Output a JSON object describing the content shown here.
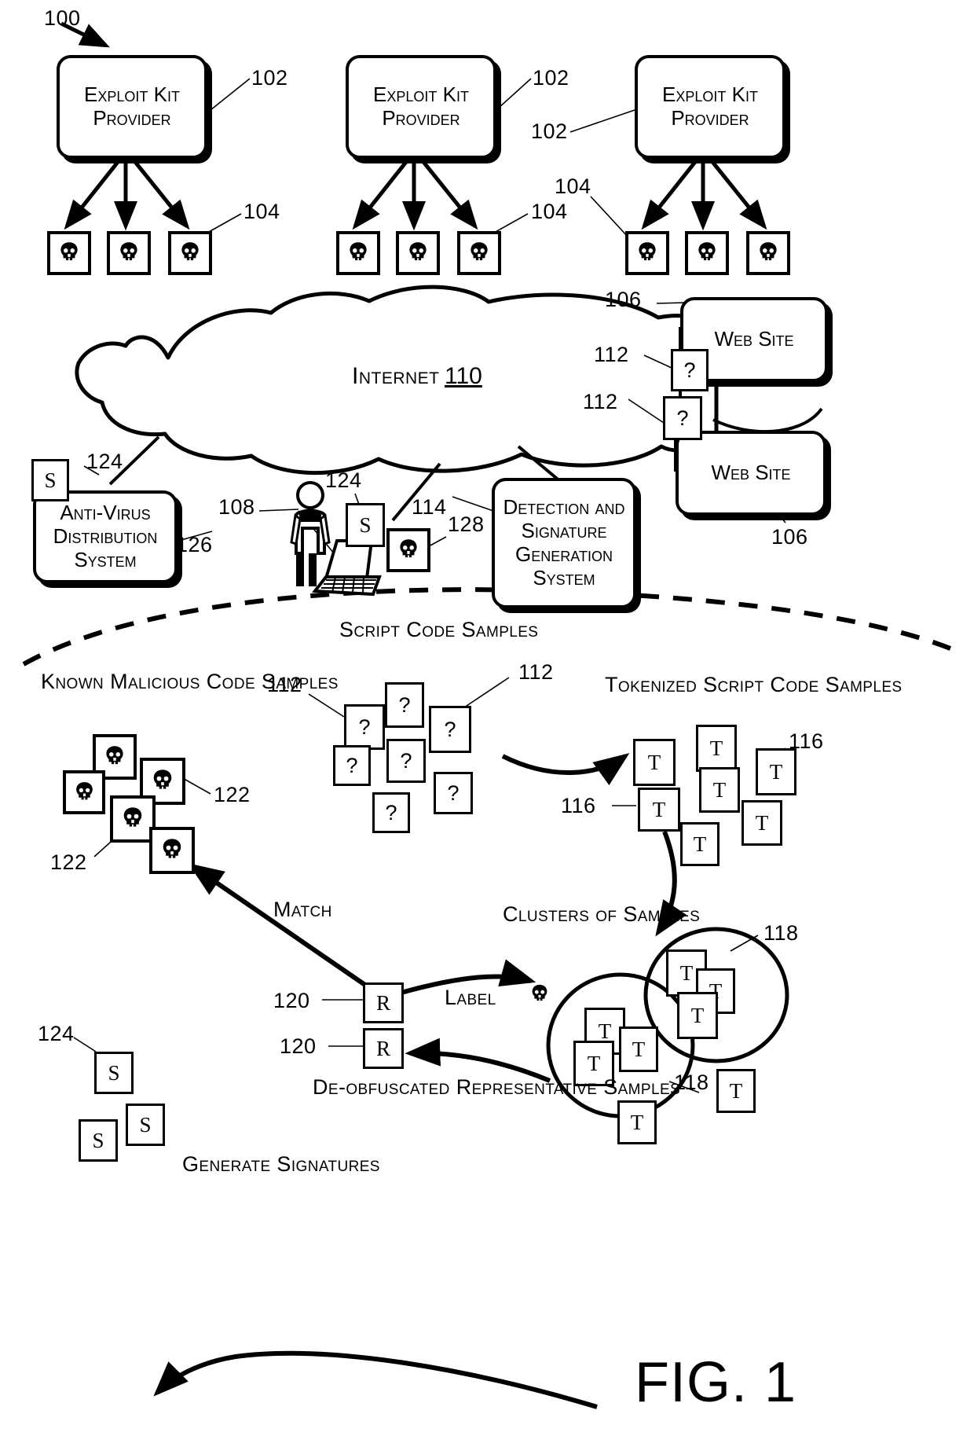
{
  "figure": {
    "number_label": "FIG. 1",
    "system_ref": "100"
  },
  "top_row": {
    "providers": [
      {
        "label": "Exploit Kit Provider",
        "ref": "102"
      },
      {
        "label": "Exploit Kit Provider",
        "ref": "102"
      },
      {
        "label": "Exploit Kit Provider",
        "ref": "102"
      }
    ],
    "provider_extra_ref": "102",
    "malicious_code_refs": [
      "104",
      "104",
      "104"
    ],
    "malicious_icon": "skull-icon"
  },
  "network": {
    "cloud_label": "Internet",
    "cloud_ref": "110",
    "websites": [
      {
        "label": "Web Site",
        "ref": "106"
      },
      {
        "label": "Web Site",
        "ref": "106"
      }
    ],
    "script_refs": [
      "112",
      "112"
    ],
    "script_glyph": "?"
  },
  "systems": {
    "antivirus": {
      "label": "Anti-Virus Distribution System",
      "ref": "126"
    },
    "detection": {
      "label": "Detection and Signature Generation System",
      "ref": "114"
    },
    "signature_glyph": "S",
    "signature_ref_left": "124",
    "signature_ref_user": "124",
    "user_ref": "108",
    "infected_ref": "128"
  },
  "lower": {
    "known_malicious_title": "Known Malicious Code Samples",
    "known_malicious_refs": [
      "122",
      "122"
    ],
    "script_code_title": "Script Code Samples",
    "script_code_refs": [
      "112",
      "112"
    ],
    "script_code_glyph": "?",
    "tokenized_title": "Tokenized Script Code Samples",
    "tokenized_refs": [
      "116",
      "116"
    ],
    "tokenized_glyph": "T",
    "clusters_title": "Clusters of Samples",
    "clusters_refs": [
      "118",
      "118"
    ],
    "match_label": "Match",
    "label_label": "Label",
    "generate_label": "Generate Signatures",
    "representative_title": "De-obfuscated Representative Samples",
    "representative_refs": [
      "120",
      "120"
    ],
    "representative_glyph": "R",
    "signatures_ref": "124",
    "signature_glyph": "S"
  },
  "colors": {
    "ink": "#000000",
    "paper": "#ffffff"
  }
}
